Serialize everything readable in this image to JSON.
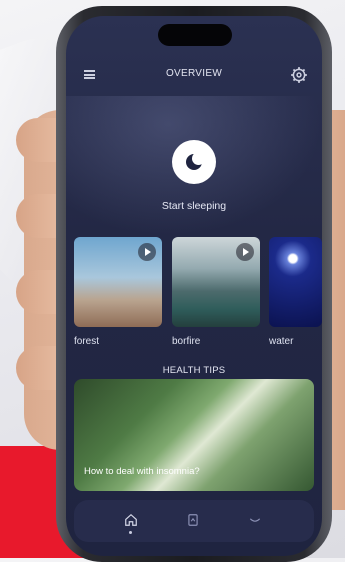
{
  "header": {
    "title": "OVERVIEW",
    "menu_icon": "menu-icon",
    "settings_icon": "gear-icon"
  },
  "hero": {
    "start_label": "Start sleeping",
    "icon": "moon-icon"
  },
  "sounds": [
    {
      "label": "forest"
    },
    {
      "label": "borfire"
    },
    {
      "label": "water"
    }
  ],
  "health_tips": {
    "title": "HEALTH TIPS",
    "article": "How to deal with insomnia?"
  },
  "nav": {
    "items": [
      "home-icon",
      "journal-icon",
      "sleep-icon"
    ],
    "active": 0
  },
  "colors": {
    "screen_bg": "#232845",
    "accent_red": "#e8192c",
    "text": "#e2e4f0"
  }
}
